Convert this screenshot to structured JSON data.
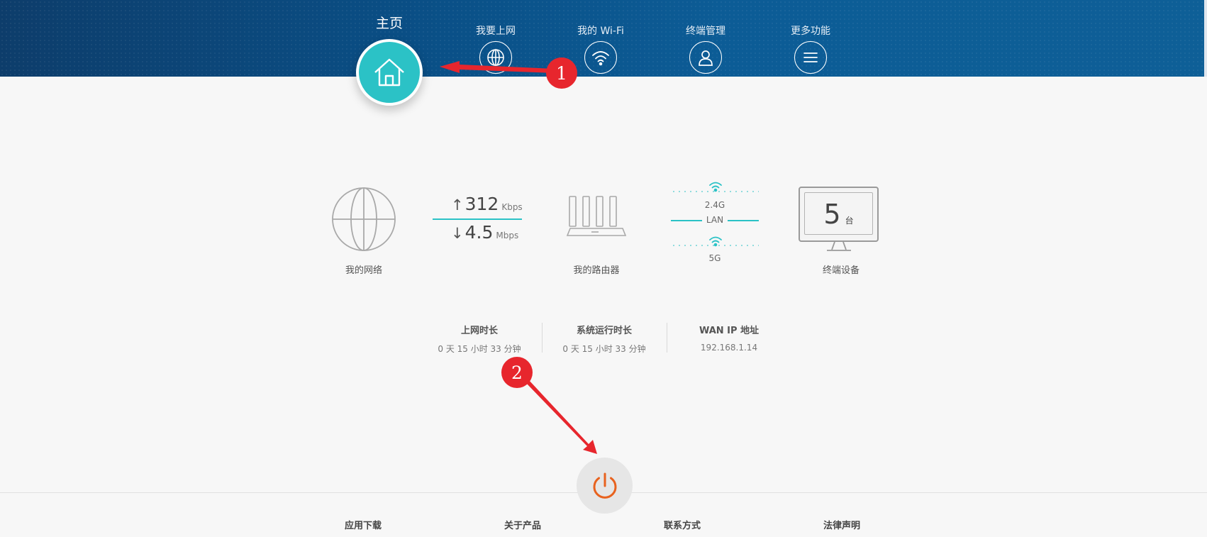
{
  "nav": {
    "home_label": "主页",
    "items": [
      {
        "label": "我要上网",
        "icon": "globe-icon"
      },
      {
        "label": "我的 Wi-Fi",
        "icon": "wifi-icon"
      },
      {
        "label": "终端管理",
        "icon": "user-icon"
      },
      {
        "label": "更多功能",
        "icon": "menu-icon"
      }
    ]
  },
  "annotations": {
    "badge1": "1",
    "badge2": "2",
    "color": "#e7262d"
  },
  "status": {
    "network_label": "我的网络",
    "upload_value": "312",
    "upload_unit": "Kbps",
    "download_value": "4.5",
    "download_unit": "Mbps",
    "up_arrow": "↑",
    "down_arrow": "↓",
    "router_label": "我的路由器",
    "band_24g": "2.4G",
    "band_lan": "LAN",
    "band_5g": "5G",
    "device_count": "5",
    "device_unit": "台",
    "devices_label": "终端设备"
  },
  "info": {
    "online_title": "上网时长",
    "online_value": "0 天 15 小时 33 分钟",
    "uptime_title": "系统运行时长",
    "uptime_value": "0 天 15 小时 33 分钟",
    "wanip_title": "WAN IP 地址",
    "wanip_value": "192.168.1.14"
  },
  "footer": {
    "items": [
      "应用下载",
      "关于产品",
      "联系方式",
      "法律声明"
    ]
  },
  "colors": {
    "accent": "#2bc2c6",
    "header": "#0a4f86",
    "power": "#e8621e"
  }
}
